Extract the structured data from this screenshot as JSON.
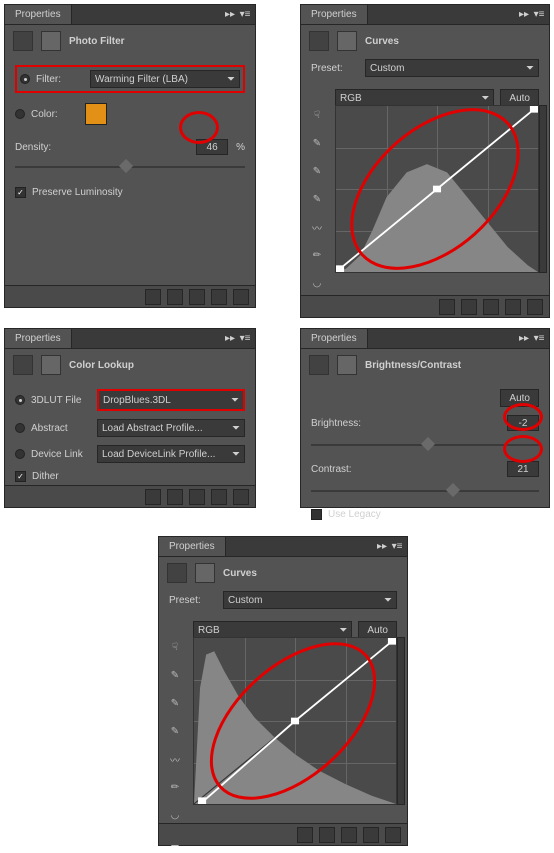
{
  "common": {
    "tab": "Properties"
  },
  "photoFilter": {
    "title": "Photo Filter",
    "filterLabel": "Filter:",
    "filterValue": "Warming Filter (LBA)",
    "colorLabel": "Color:",
    "swatchColor": "#e39017",
    "densityLabel": "Density:",
    "densityValue": "46",
    "percent": "%",
    "preserveLuminosity": "Preserve Luminosity"
  },
  "curves1": {
    "title": "Curves",
    "presetLabel": "Preset:",
    "presetValue": "Custom",
    "channelValue": "RGB",
    "autoLabel": "Auto"
  },
  "colorLookup": {
    "title": "Color Lookup",
    "lutLabel": "3DLUT File",
    "lutValue": "DropBlues.3DL",
    "abstractLabel": "Abstract",
    "abstractValue": "Load Abstract Profile...",
    "deviceLinkLabel": "Device Link",
    "deviceLinkValue": "Load DeviceLink Profile...",
    "ditherLabel": "Dither"
  },
  "brightness": {
    "title": "Brightness/Contrast",
    "autoLabel": "Auto",
    "brightnessLabel": "Brightness:",
    "brightnessValue": "-2",
    "contrastLabel": "Contrast:",
    "contrastValue": "21",
    "useLegacy": "Use Legacy"
  },
  "curves2": {
    "title": "Curves",
    "presetLabel": "Preset:",
    "presetValue": "Custom",
    "channelValue": "RGB",
    "autoLabel": "Auto"
  }
}
